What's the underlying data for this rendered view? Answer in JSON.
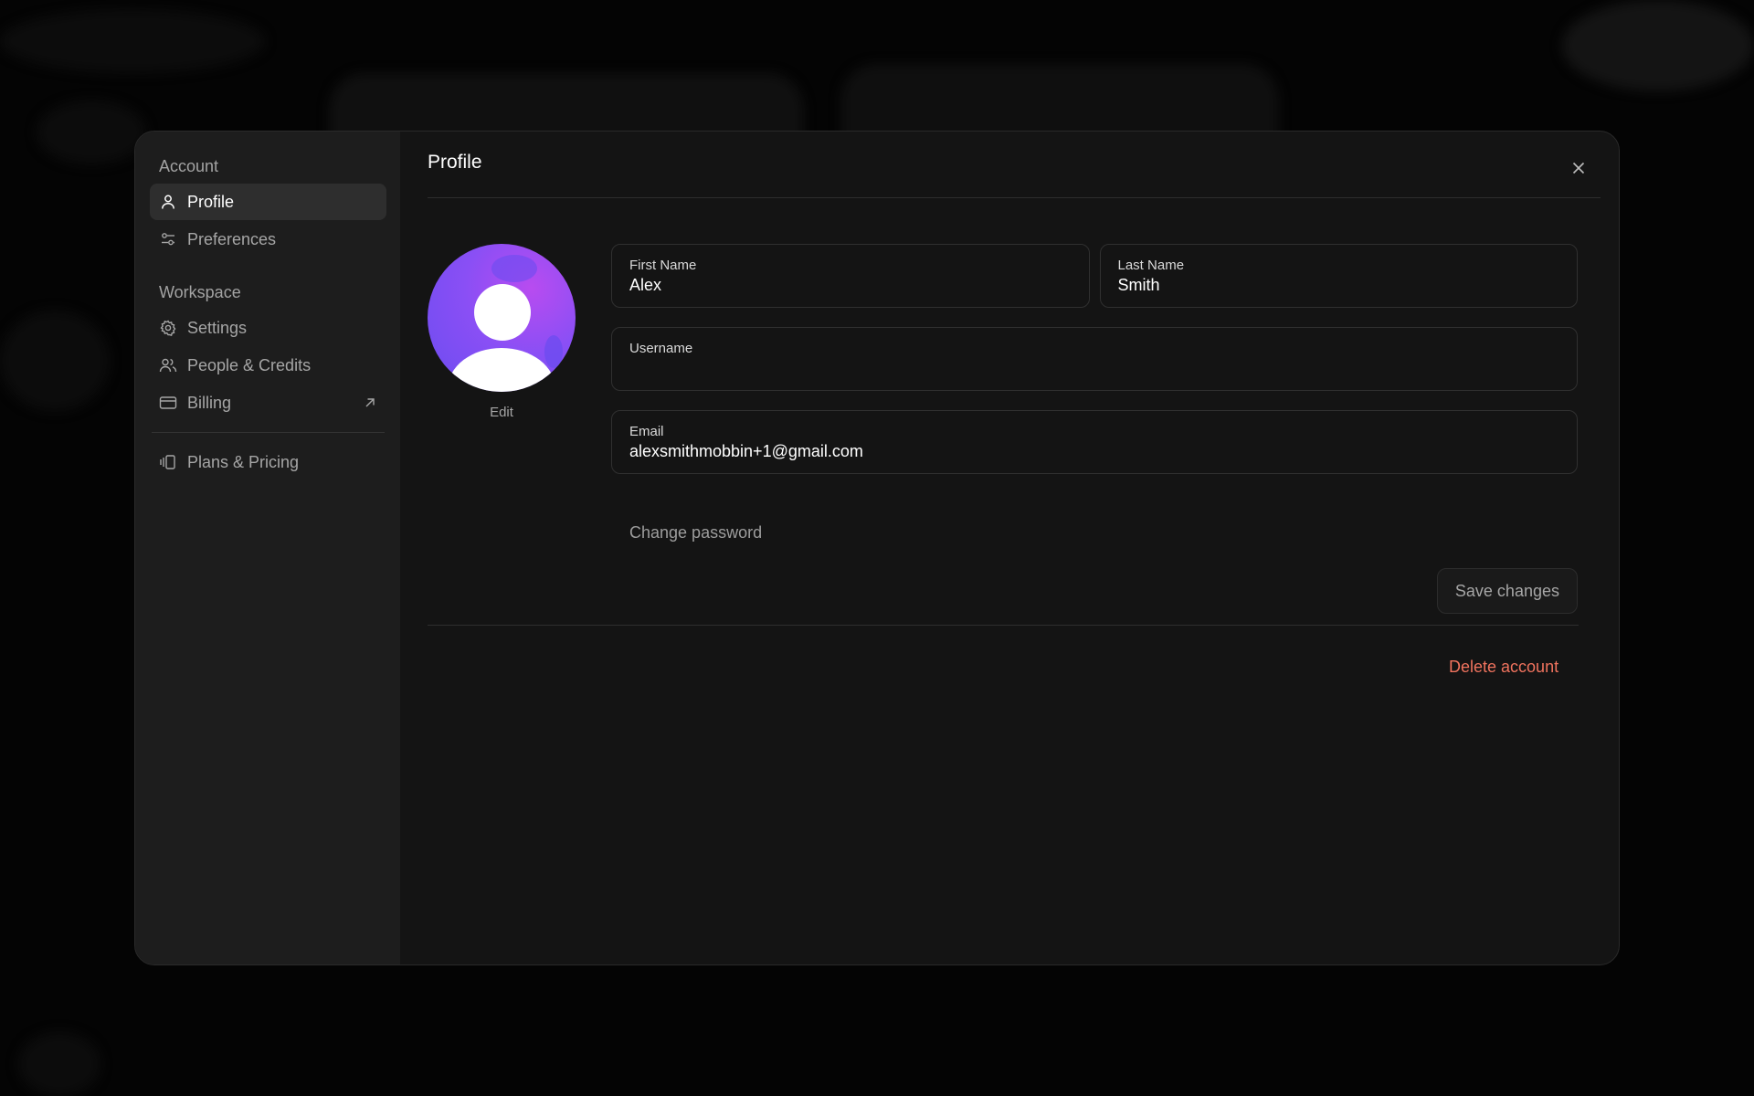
{
  "sidebar": {
    "account_label": "Account",
    "workspace_label": "Workspace",
    "account_items": [
      {
        "label": "Profile",
        "icon": "user-icon",
        "active": true
      },
      {
        "label": "Preferences",
        "icon": "sliders-icon"
      }
    ],
    "workspace_items": [
      {
        "label": "Settings",
        "icon": "gear-icon"
      },
      {
        "label": "People & Credits",
        "icon": "users-icon"
      },
      {
        "label": "Billing",
        "icon": "credit-card-icon",
        "external": true
      }
    ],
    "extra_items": [
      {
        "label": "Plans & Pricing",
        "icon": "cards-icon"
      }
    ]
  },
  "header": {
    "title": "Profile"
  },
  "avatar": {
    "edit_label": "Edit"
  },
  "form": {
    "first_name": {
      "label": "First Name",
      "value": "Alex"
    },
    "last_name": {
      "label": "Last Name",
      "value": "Smith"
    },
    "username": {
      "label": "Username",
      "value": ""
    },
    "email": {
      "label": "Email",
      "value": "alexsmithmobbin+1@gmail.com"
    },
    "change_password_label": "Change password",
    "save_label": "Save changes"
  },
  "danger": {
    "delete_label": "Delete account"
  },
  "colors": {
    "accent_purple": "#8a4ff5",
    "danger": "#f0735e",
    "sidebar_bg": "#1d1d1d",
    "main_bg": "#141414"
  }
}
